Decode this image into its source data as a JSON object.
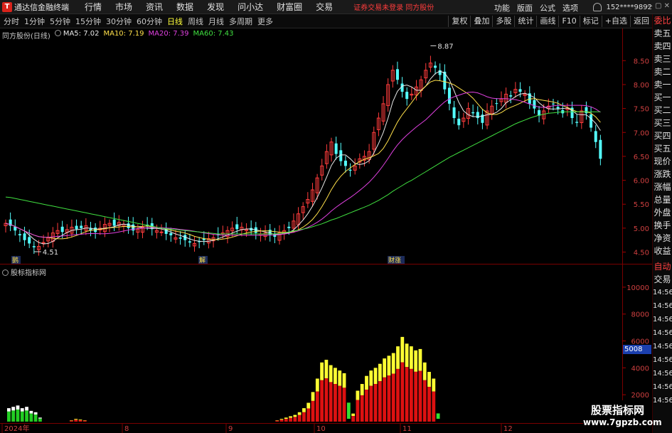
{
  "app": {
    "title": "通达信金融终端",
    "menu": [
      "行情",
      "市场",
      "资讯",
      "数据",
      "发现",
      "问小达",
      "财富圈",
      "交易"
    ],
    "notice": "证券交易未登录  同方股份",
    "right_menu": [
      "功能",
      "版面",
      "公式",
      "选项"
    ],
    "account": "152****9892"
  },
  "toolbar": {
    "periods": [
      "分时",
      "1分钟",
      "5分钟",
      "15分钟",
      "30分钟",
      "60分钟",
      "日线",
      "周线",
      "月线",
      "多周期",
      "更多"
    ],
    "active_period": "日线",
    "right_buttons": [
      "复权",
      "叠加",
      "多股",
      "统计",
      "画线",
      "F10",
      "标记",
      "+自选",
      "返回"
    ]
  },
  "main_chart": {
    "stock_label": "同方股份(日线)",
    "ma": [
      {
        "label": "MA5: 7.02",
        "color": "#e8e8e8"
      },
      {
        "label": "MA10: 7.19",
        "color": "#ffe04a"
      },
      {
        "label": "MA20: 7.39",
        "color": "#e040e0"
      },
      {
        "label": "MA60: 7.43",
        "color": "#40e040"
      }
    ],
    "price_ticks": [
      "8.50",
      "8.00",
      "7.50",
      "7.00",
      "6.50",
      "6.00",
      "5.50",
      "5.00",
      "4.50"
    ],
    "high_mark": "8.87",
    "low_mark": "4.51",
    "event_marks": [
      "鹅",
      "解",
      "财涨"
    ]
  },
  "indicator": {
    "label": "股标指标网",
    "ticks": [
      "10000",
      "8000",
      "6000",
      "4000",
      "2000"
    ],
    "current_value": "5008"
  },
  "x_axis": [
    "2024年",
    "8",
    "9",
    "10",
    "11",
    "12"
  ],
  "right_panel": {
    "items": [
      "委比",
      "卖五",
      "卖四",
      "卖三",
      "卖二",
      "卖一",
      "买一",
      "买二",
      "买三",
      "买四",
      "买五",
      "现价",
      "涨跌",
      "涨幅",
      "总量",
      "外盘",
      "换手",
      "净资",
      "收益"
    ],
    "auto_label": "自动",
    "trade_label": "交易",
    "times": [
      "14:56",
      "14:56",
      "14:56",
      "14:56",
      "14:56",
      "14:56",
      "14:56",
      "14:56",
      "14:56"
    ]
  },
  "watermark": {
    "line1": "股票指标网",
    "line2": "www.7gpzb.com"
  },
  "chart_data": {
    "type": "candlestick",
    "y_range": [
      4.3,
      8.95
    ],
    "closes": [
      5.1,
      5.05,
      4.95,
      4.85,
      4.75,
      4.68,
      4.6,
      4.62,
      4.7,
      4.8,
      4.9,
      4.95,
      4.92,
      4.97,
      5.02,
      4.98,
      5.0,
      5.05,
      4.95,
      4.92,
      5.0,
      5.08,
      5.1,
      5.05,
      5.12,
      5.08,
      5.0,
      4.95,
      4.98,
      5.02,
      5.05,
      4.98,
      4.95,
      4.92,
      4.88,
      4.85,
      4.8,
      4.78,
      4.75,
      4.7,
      4.68,
      4.72,
      4.75,
      4.78,
      4.8,
      4.85,
      4.9,
      4.95,
      5.0,
      4.98,
      5.02,
      4.97,
      4.95,
      4.9,
      4.88,
      4.9,
      4.85,
      4.82,
      4.9,
      4.95,
      5.0,
      5.15,
      5.3,
      5.45,
      5.6,
      5.8,
      6.05,
      6.3,
      6.6,
      6.8,
      6.55,
      6.4,
      6.3,
      6.2,
      6.3,
      6.45,
      6.5,
      6.6,
      7.0,
      7.3,
      7.6,
      8.0,
      8.3,
      8.1,
      7.85,
      7.7,
      7.8,
      7.95,
      8.1,
      8.3,
      8.45,
      8.35,
      8.2,
      7.9,
      7.6,
      7.3,
      7.15,
      7.3,
      7.5,
      7.4,
      7.3,
      7.2,
      7.45,
      7.55,
      7.6,
      7.7,
      7.8,
      7.75,
      7.9,
      7.85,
      7.8,
      7.6,
      7.5,
      7.35,
      7.45,
      7.55,
      7.6,
      7.5,
      7.4,
      7.5,
      7.3,
      7.2,
      7.45,
      7.4,
      7.1,
      6.8,
      6.45
    ],
    "ma60": [
      5.65,
      5.64,
      5.62,
      5.6,
      5.58,
      5.56,
      5.54,
      5.52,
      5.5,
      5.48,
      5.46,
      5.44,
      5.42,
      5.4,
      5.38,
      5.36,
      5.34,
      5.32,
      5.3,
      5.28,
      5.26,
      5.24,
      5.22,
      5.2,
      5.18,
      5.16,
      5.14,
      5.12,
      5.1,
      5.08,
      5.06,
      5.04,
      5.02,
      5.0,
      4.99,
      4.98,
      4.97,
      4.96,
      4.95,
      4.94,
      4.93,
      4.92,
      4.91,
      4.9,
      4.89,
      4.88,
      4.88,
      4.88,
      4.88,
      4.88,
      4.88,
      4.88,
      4.88,
      4.88,
      4.88,
      4.88,
      4.88,
      4.88,
      4.89,
      4.9,
      4.92,
      4.94,
      4.96,
      4.98,
      5.0,
      5.03,
      5.06,
      5.09,
      5.13,
      5.17,
      5.2,
      5.24,
      5.28,
      5.32,
      5.36,
      5.4,
      5.44,
      5.48,
      5.53,
      5.58,
      5.64,
      5.7,
      5.77,
      5.83,
      5.89,
      5.95,
      6.0,
      6.06,
      6.12,
      6.18,
      6.24,
      6.3,
      6.36,
      6.42,
      6.48,
      6.53,
      6.58,
      6.63,
      6.68,
      6.73,
      6.78,
      6.83,
      6.88,
      6.93,
      6.98,
      7.03,
      7.08,
      7.13,
      7.18,
      7.22,
      7.26,
      7.3,
      7.33,
      7.36,
      7.38,
      7.4,
      7.41,
      7.42,
      7.43,
      7.43,
      7.43,
      7.43,
      7.43,
      7.43,
      7.43,
      7.43,
      7.43
    ],
    "indicator_bars": [
      1000,
      1100,
      1200,
      1000,
      1100,
      800,
      700,
      300,
      0,
      0,
      0,
      0,
      0,
      0,
      100,
      200,
      150,
      100,
      0,
      0,
      0,
      0,
      0,
      0,
      0,
      0,
      0,
      0,
      0,
      0,
      0,
      0,
      0,
      0,
      0,
      0,
      0,
      0,
      0,
      0,
      0,
      0,
      0,
      0,
      0,
      0,
      0,
      0,
      0,
      0,
      0,
      0,
      0,
      0,
      0,
      0,
      0,
      0,
      0,
      0,
      100,
      200,
      300,
      400,
      500,
      700,
      1000,
      1400,
      2200,
      3200,
      4400,
      4600,
      4200,
      4000,
      3800,
      3600,
      -1200,
      600,
      2300,
      2800,
      3400,
      3800,
      4000,
      4300,
      4700,
      4900,
      5100,
      5600,
      6300,
      5800,
      5600,
      5300,
      5400,
      4400,
      3700,
      3200,
      -400
    ]
  }
}
